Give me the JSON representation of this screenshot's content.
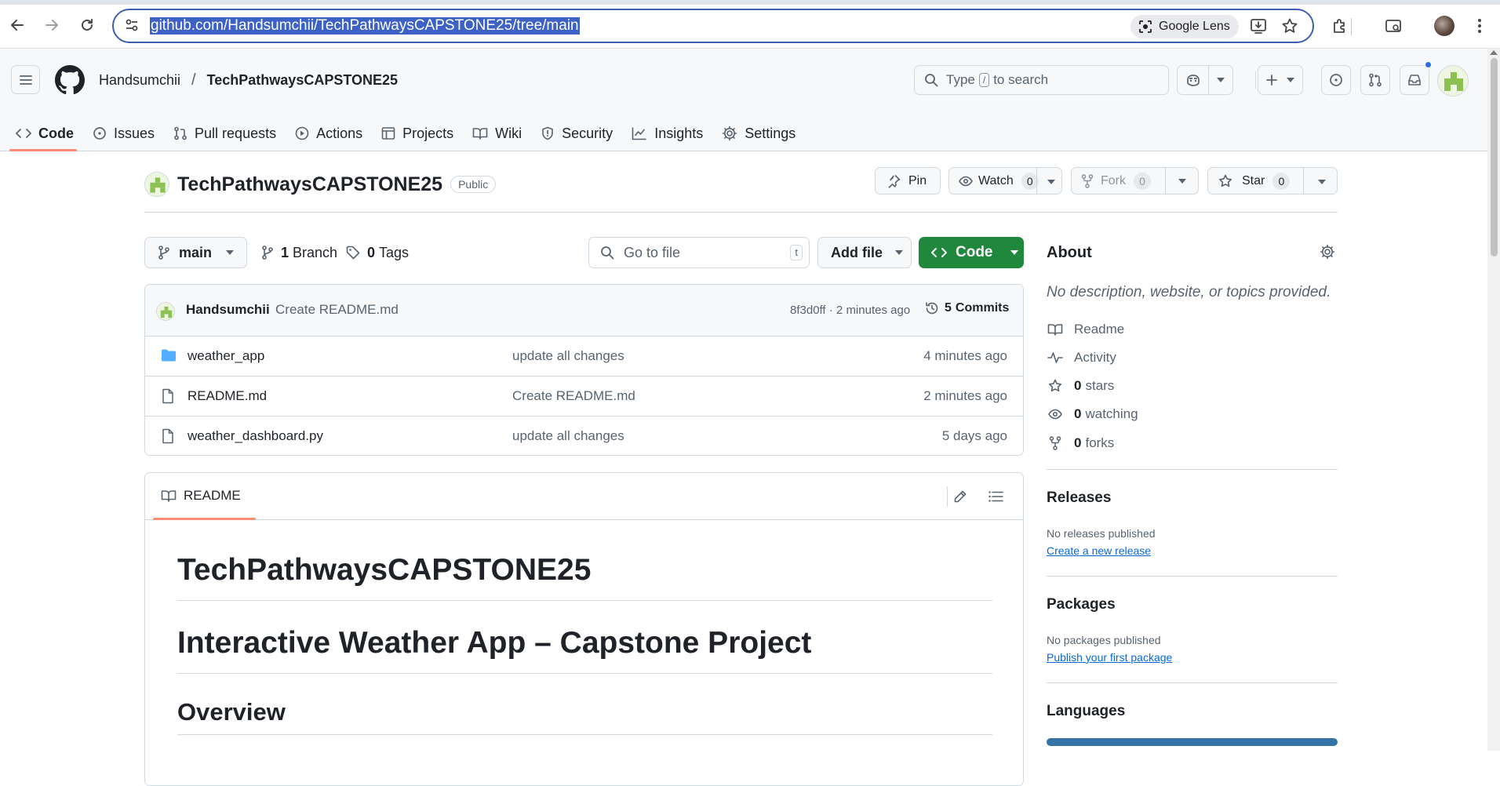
{
  "browser": {
    "url": "github.com/Handsumchii/TechPathwaysCAPSTONE25/tree/main",
    "lens_label": "Google Lens"
  },
  "header": {
    "owner": "Handsumchii",
    "separator": "/",
    "repo": "TechPathwaysCAPSTONE25",
    "search_prefix": "Type",
    "search_key": "/",
    "search_suffix": "to search"
  },
  "repo_nav": [
    {
      "label": "Code",
      "icon": "code-icon",
      "active": true
    },
    {
      "label": "Issues",
      "icon": "issue-icon"
    },
    {
      "label": "Pull requests",
      "icon": "pull-request-icon"
    },
    {
      "label": "Actions",
      "icon": "play-icon"
    },
    {
      "label": "Projects",
      "icon": "table-icon"
    },
    {
      "label": "Wiki",
      "icon": "book-icon"
    },
    {
      "label": "Security",
      "icon": "shield-icon"
    },
    {
      "label": "Insights",
      "icon": "graph-icon"
    },
    {
      "label": "Settings",
      "icon": "gear-icon"
    }
  ],
  "repo_head": {
    "title": "TechPathwaysCAPSTONE25",
    "visibility": "Public",
    "pin_label": "Pin",
    "watch_label": "Watch",
    "watch_count": "0",
    "fork_label": "Fork",
    "fork_count": "0",
    "star_label": "Star",
    "star_count": "0"
  },
  "file_nav": {
    "branch": "main",
    "branch_count": "1",
    "branch_label": "Branch",
    "tag_count": "0",
    "tag_label": "Tags",
    "goto_placeholder": "Go to file",
    "goto_key": "t",
    "add_file_label": "Add file",
    "code_label": "Code"
  },
  "latest_commit": {
    "author": "Handsumchii",
    "message": "Create README.md",
    "sha_time": "8f3d0ff · 2 minutes ago",
    "commits_count": "5",
    "commits_label": "Commits"
  },
  "files": [
    {
      "name": "weather_app",
      "type": "folder",
      "message": "update all changes",
      "age": "4 minutes ago"
    },
    {
      "name": "README.md",
      "type": "file",
      "message": "Create README.md",
      "age": "2 minutes ago"
    },
    {
      "name": "weather_dashboard.py",
      "type": "file",
      "message": "update all changes",
      "age": "5 days ago"
    }
  ],
  "readme": {
    "tab_label": "README",
    "h1": "TechPathwaysCAPSTONE25",
    "h1b": "Interactive Weather App – Capstone Project",
    "h2": "Overview"
  },
  "about": {
    "title": "About",
    "description": "No description, website, or topics provided.",
    "readme_label": "Readme",
    "activity_label": "Activity",
    "stars_count": "0",
    "stars_label": "stars",
    "watching_count": "0",
    "watching_label": "watching",
    "forks_count": "0",
    "forks_label": "forks"
  },
  "releases": {
    "title": "Releases",
    "empty": "No releases published",
    "link": "Create a new release"
  },
  "packages": {
    "title": "Packages",
    "empty": "No packages published",
    "link": "Publish your first package"
  },
  "languages": {
    "title": "Languages",
    "bar_color": "#3572a5"
  },
  "colors": {
    "accent_green": "#1f883d",
    "tab_underline": "#fd8c73",
    "link_blue": "#0969da"
  }
}
